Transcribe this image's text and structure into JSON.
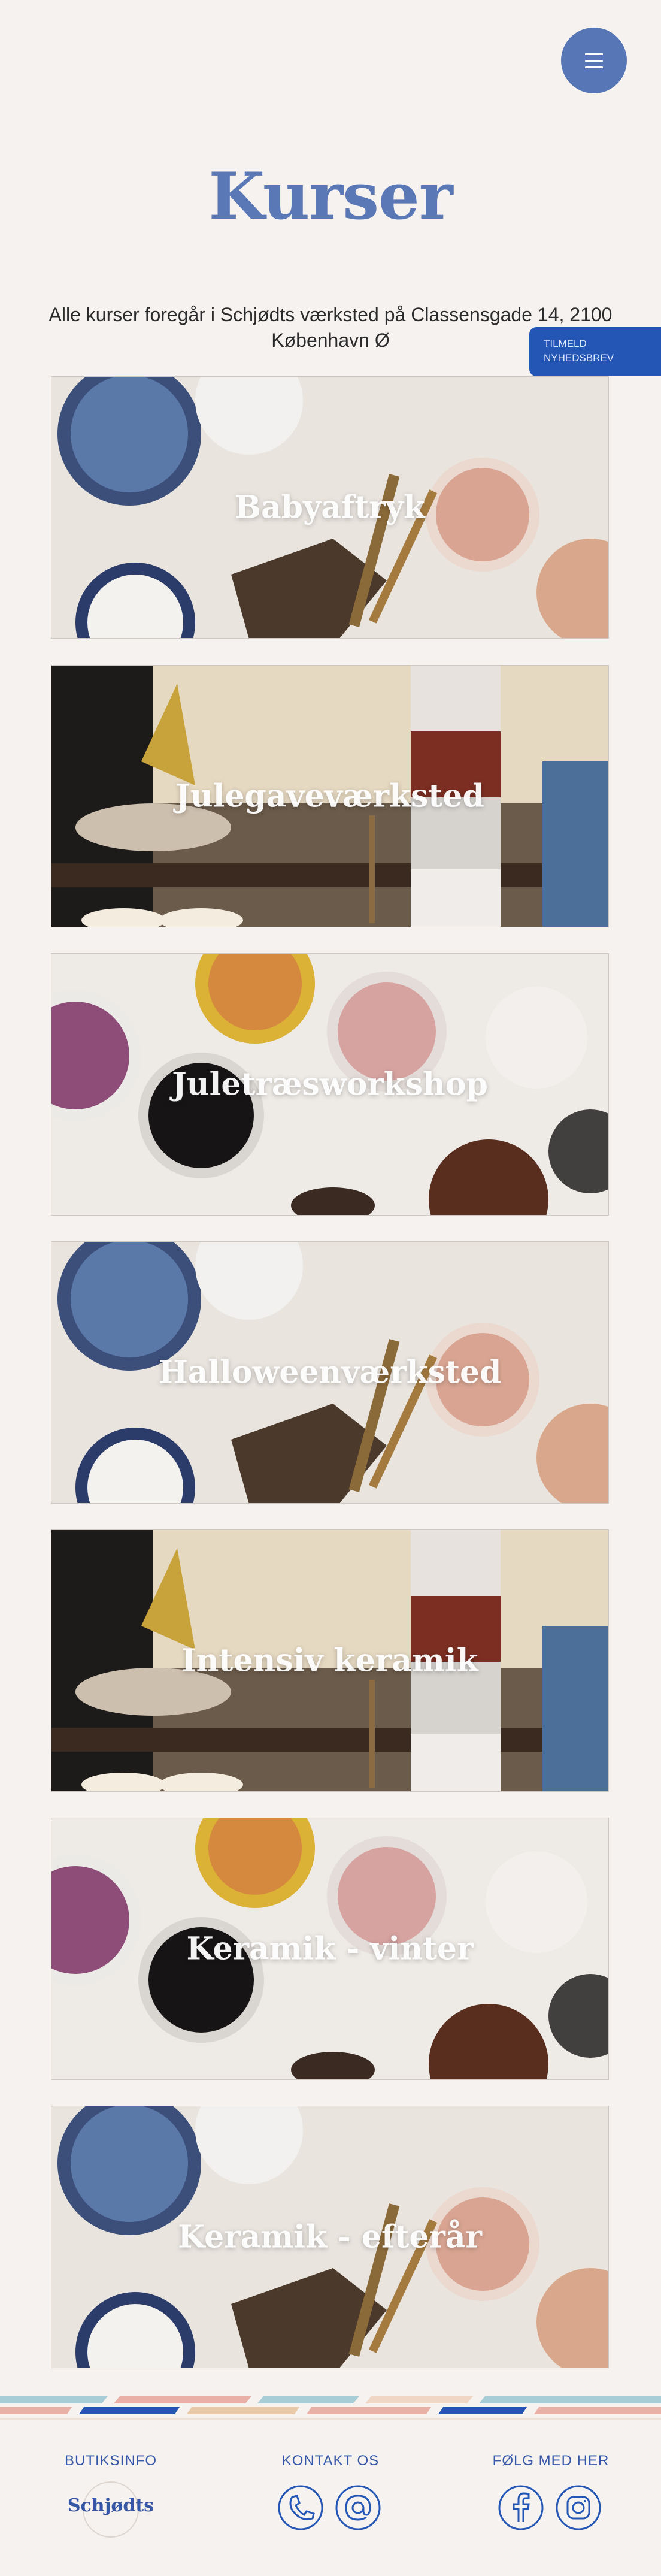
{
  "header": {
    "menu_icon": "hamburger-menu-icon",
    "page_title": "Kurser",
    "subtitle": "Alle kurser foregår i Schjødts værksted på Classensgade 14, 2100 København Ø"
  },
  "newsletter": {
    "label_line1": "TILMELD",
    "label_line2": "NYHEDSBREV"
  },
  "courses": [
    {
      "title": "Babyaftryk",
      "image": "paint-pots-blue"
    },
    {
      "title": "Julegaveværksted",
      "image": "workshop-jars"
    },
    {
      "title": "Juletræsworkshop",
      "image": "paint-pots-pink"
    },
    {
      "title": "Halloweenværksted",
      "image": "paint-pots-blue"
    },
    {
      "title": "Intensiv keramik",
      "image": "workshop-jars"
    },
    {
      "title": "Keramik - vinter",
      "image": "paint-pots-pink"
    },
    {
      "title": "Keramik - efterår",
      "image": "paint-pots-blue"
    }
  ],
  "footer": {
    "shop_info": "BUTIKSINFO",
    "logo_text": "Schjødts",
    "contact": "KONTAKT OS",
    "follow": "FØLG MED HER",
    "icons": [
      "phone-icon",
      "at-sign-icon",
      "facebook-icon",
      "instagram-icon"
    ]
  },
  "colors": {
    "accent": "#5676b5",
    "title": "#5a78b6",
    "newsletter_bg": "#2456b6",
    "background": "#f6f2f0",
    "footer_text": "#3656a6"
  }
}
